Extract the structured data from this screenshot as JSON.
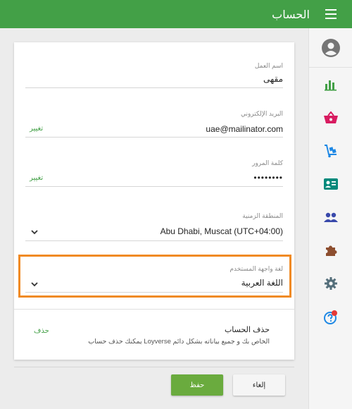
{
  "topbar": {
    "title": "الحساب"
  },
  "form": {
    "business_name": {
      "label": "اسم العمل",
      "value": "مقهى"
    },
    "email": {
      "label": "البريد الإلكتروني",
      "value": "uae@mailinator.com",
      "action": "تغيير"
    },
    "password": {
      "label": "كلمة المرور",
      "value": "••••••••",
      "action": "تغيير"
    },
    "timezone": {
      "label": "المنطقة الزمنية",
      "value": "Abu Dhabi, Muscat (UTC+04:00)"
    },
    "language": {
      "label": "لغة واجهة المستخدم",
      "value": "اللغة العربية"
    }
  },
  "delete_account": {
    "title": "حذف الحساب",
    "description": "يمكنك حذف حساب Loyverse الخاص بك و جميع بياناته بشكل دائم",
    "action": "حذف"
  },
  "buttons": {
    "save": "حفظ",
    "cancel": "إلغاء"
  },
  "sidebar": {
    "icons": [
      "account-icon",
      "reports-icon",
      "items-icon",
      "inventory-icon",
      "customers-icon",
      "employees-icon",
      "integrations-icon",
      "settings-icon",
      "help-icon"
    ]
  },
  "colors": {
    "brand": "#43a047",
    "highlight": "#f08a24",
    "notification": "#e53935"
  }
}
